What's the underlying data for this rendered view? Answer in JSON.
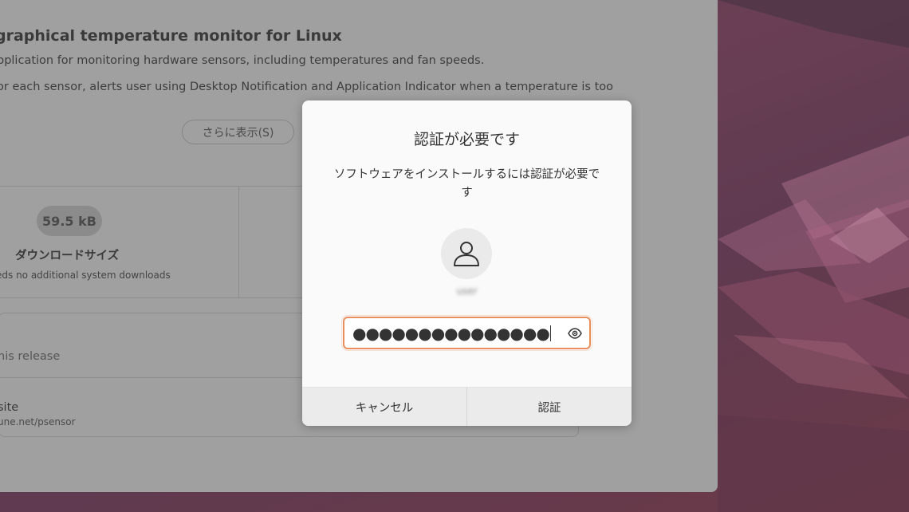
{
  "app_page": {
    "title": "graphical temperature monitor for Linux",
    "summary": "pplication for monitoring hardware sensors, including temperatures and fan speeds.",
    "description": "or each sensor, alerts user using Desktop Notification and Application Indicator when a temperature is too",
    "show_more_label": "さらに表示(S)",
    "download_size": {
      "value": "59.5 kB",
      "label": "ダウンロードサイズ",
      "note": "eds no additional system downloads"
    },
    "release_note": "his release",
    "website": {
      "label": "site",
      "url": "une.net/psensor"
    }
  },
  "auth_dialog": {
    "title": "認証が必要です",
    "message": "ソフトウェアをインストールするには認証が必要です",
    "user_name": "user",
    "password_masked": "●●●●●●●●●●●●●●●",
    "cancel_label": "キャンセル",
    "authenticate_label": "認証"
  },
  "colors": {
    "focus_ring": "#e98e5c",
    "dialog_background": "#fafafa",
    "button_bar": "#ebebeb"
  },
  "icons": {
    "avatar": "user-icon",
    "reveal": "eye-icon"
  }
}
